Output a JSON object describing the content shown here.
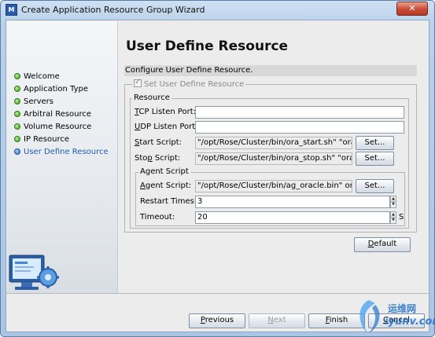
{
  "window": {
    "title": "Create Application Resource Group Wizard",
    "close_label": "✕",
    "app_icon_text": "M"
  },
  "sidebar": {
    "steps": [
      {
        "label": "Welcome",
        "state": "done"
      },
      {
        "label": "Application Type",
        "state": "done"
      },
      {
        "label": "Servers",
        "state": "done"
      },
      {
        "label": "Arbitral Resource",
        "state": "done"
      },
      {
        "label": "Volume Resource",
        "state": "done"
      },
      {
        "label": "IP Resource",
        "state": "done"
      },
      {
        "label": "User Define Resource",
        "state": "current"
      }
    ]
  },
  "page": {
    "title": "User Define Resource",
    "subtitle": "Configure User Define Resource."
  },
  "set_user_define": {
    "label": "Set User Define Resource",
    "checked": true,
    "enabled": false
  },
  "resource": {
    "legend": "Resource",
    "tcp_port": {
      "label_mnemonic": "T",
      "label_rest": "CP Listen Port:",
      "value": ""
    },
    "udp_port": {
      "label_mnemonic": "U",
      "label_rest": "DP Listen Port:",
      "value": ""
    },
    "start_script": {
      "label_mnemonic": "S",
      "label_rest": "tart Script:",
      "value": "\"/opt/Rose/Cluster/bin/ora_start.sh\" \"ora_l",
      "button": "Set..."
    },
    "stop_script": {
      "label_pre": "Sto",
      "label_mnemonic": "p",
      "label_rest": " Script:",
      "value": "\"/opt/Rose/Cluster/bin/ora_stop.sh\" \"ora_l",
      "button": "Set..."
    }
  },
  "agent": {
    "legend": "Agent Script",
    "script": {
      "label_mnemonic": "A",
      "label_rest": "gent Script:",
      "value": "\"/opt/Rose/Cluster/bin/ag_oracle.bin\" ora_",
      "button": "Set..."
    },
    "restart_times": {
      "label": "Restart Times:",
      "value": "3"
    },
    "timeout": {
      "label": "Timeout:",
      "value": "20",
      "unit": "S"
    }
  },
  "buttons": {
    "default": {
      "mnemonic": "D",
      "rest": "efault"
    },
    "previous": {
      "mnemonic": "P",
      "rest": "revious"
    },
    "next": {
      "mnemonic": "N",
      "rest": "ext",
      "enabled": false
    },
    "finish": {
      "mnemonic": "F",
      "rest": "inish"
    },
    "cancel": {
      "mnemonic": "C",
      "rest": "ancel"
    }
  },
  "watermark": {
    "cn_text": "运维网",
    "url": "iyunv.com"
  },
  "colors": {
    "accent": "#1f5eb0",
    "done_dot": "#3f9a1c",
    "titlebar": "#b9d1ea",
    "close": "#c94a35"
  }
}
